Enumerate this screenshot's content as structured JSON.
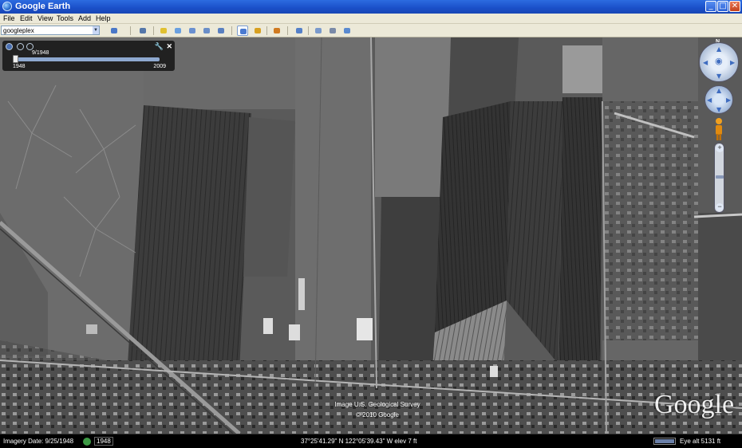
{
  "window": {
    "title": "Google Earth",
    "minimize": "_",
    "maximize": "□",
    "close": "✕"
  },
  "menu": [
    "File",
    "Edit",
    "View",
    "Tools",
    "Add",
    "Help"
  ],
  "search": {
    "value": "googleplex"
  },
  "toolbar": {
    "icons": [
      "hide-sidebar-icon",
      "placemark-icon",
      "polygon-icon",
      "path-icon",
      "image-overlay-icon",
      "record-tour-icon",
      "historical-imagery-icon",
      "sunlight-icon",
      "planets-icon",
      "ruler-icon",
      "email-icon",
      "print-icon",
      "view-in-maps-icon"
    ]
  },
  "time_slider": {
    "current_date": "9/1948",
    "start_year": "1948",
    "end_year": "2009",
    "position": 0.0
  },
  "navigation": {
    "north_label": "N",
    "zoom_in": "+",
    "zoom_out": "−"
  },
  "map": {
    "credit_line1": "Image U.S. Geological Survey",
    "credit_line2": "© 2010 Google",
    "logo_text": "Google"
  },
  "status": {
    "imagery_date": "Imagery Date: 9/25/1948",
    "historical_year": "1948",
    "coordinates": "37°25'41.29\" N 122°05'39.43\" W  elev   7 ft",
    "eye_alt": "Eye alt    5131 ft"
  },
  "colors": {
    "titlebar": "#1a4fc8",
    "chrome": "#ece9d8",
    "accent": "#3e6cc0"
  }
}
